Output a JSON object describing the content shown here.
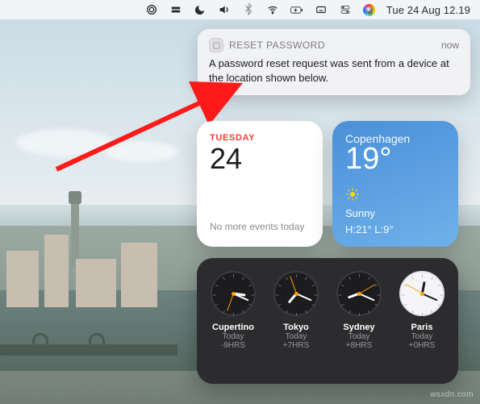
{
  "menubar": {
    "datetime": "Tue 24 Aug  12.19"
  },
  "notification": {
    "app_name": "RESET PASSWORD",
    "time_label": "now",
    "body": "A password reset request was sent from a device at the location shown below."
  },
  "calendar": {
    "day_of_week": "TUESDAY",
    "day_number": "24",
    "events_label": "No more events today"
  },
  "weather": {
    "city": "Copenhagen",
    "temperature": "19°",
    "condition": "Sunny",
    "hi_lo": "H:21° L:9°"
  },
  "clocks": [
    {
      "city": "Cupertino",
      "day": "Today",
      "offset": "-9HRS",
      "theme": "dark",
      "h_deg": 98,
      "m_deg": 114,
      "s_deg": 200
    },
    {
      "city": "Tokyo",
      "day": "Today",
      "offset": "+7HRS",
      "theme": "dark",
      "h_deg": 220,
      "m_deg": 114,
      "s_deg": 340
    },
    {
      "city": "Sydney",
      "day": "Today",
      "offset": "+8HRS",
      "theme": "dark",
      "h_deg": 250,
      "m_deg": 114,
      "s_deg": 60
    },
    {
      "city": "Paris",
      "day": "Today",
      "offset": "+0HRS",
      "theme": "light",
      "h_deg": 10,
      "m_deg": 114,
      "s_deg": 300
    }
  ],
  "watermark": "wsxdn.com"
}
